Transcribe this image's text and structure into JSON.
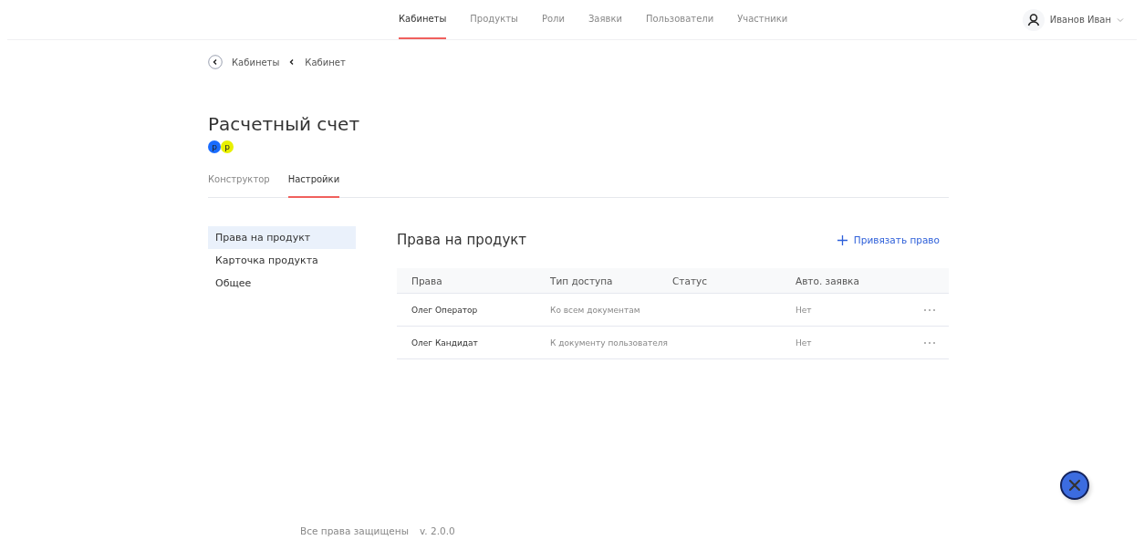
{
  "nav": [
    {
      "label": "Кабинеты",
      "selected": true
    },
    {
      "label": "Продукты",
      "selected": false
    },
    {
      "label": "Роли",
      "selected": false
    },
    {
      "label": "Заявки",
      "selected": false
    },
    {
      "label": "Пользователи",
      "selected": false
    },
    {
      "label": "Участники",
      "selected": false
    }
  ],
  "user": {
    "name": "Иванов Иван"
  },
  "breadcrumbs": [
    "Кабинеты",
    "Кабинет"
  ],
  "title": "Расчетный счет",
  "badges": [
    {
      "letter": "p",
      "color": "#1a6cff"
    },
    {
      "letter": "p",
      "color": "#e8f000"
    }
  ],
  "tabs": [
    {
      "label": "Конструктор",
      "selected": false
    },
    {
      "label": "Настройки",
      "selected": true
    }
  ],
  "sidebar": {
    "items": [
      {
        "label": "Права на продукт",
        "selected": true
      },
      {
        "label": "Карточка продукта",
        "selected": false
      },
      {
        "label": "Общее",
        "selected": false
      }
    ]
  },
  "section": {
    "title": "Права на продукт",
    "action": "Привязать право"
  },
  "table": {
    "columns": [
      "Права",
      "Тип доступа",
      "Статус",
      "Авто. заявка"
    ],
    "rows": [
      {
        "name": "Олег Оператор",
        "access": "Ко всем документам",
        "auto": "Нет"
      },
      {
        "name": "Олег Кандидат",
        "access": "К документу пользователя",
        "auto": "Нет"
      }
    ]
  },
  "footer": {
    "rights": "Все права защищены",
    "version": "v. 2.0.0"
  }
}
